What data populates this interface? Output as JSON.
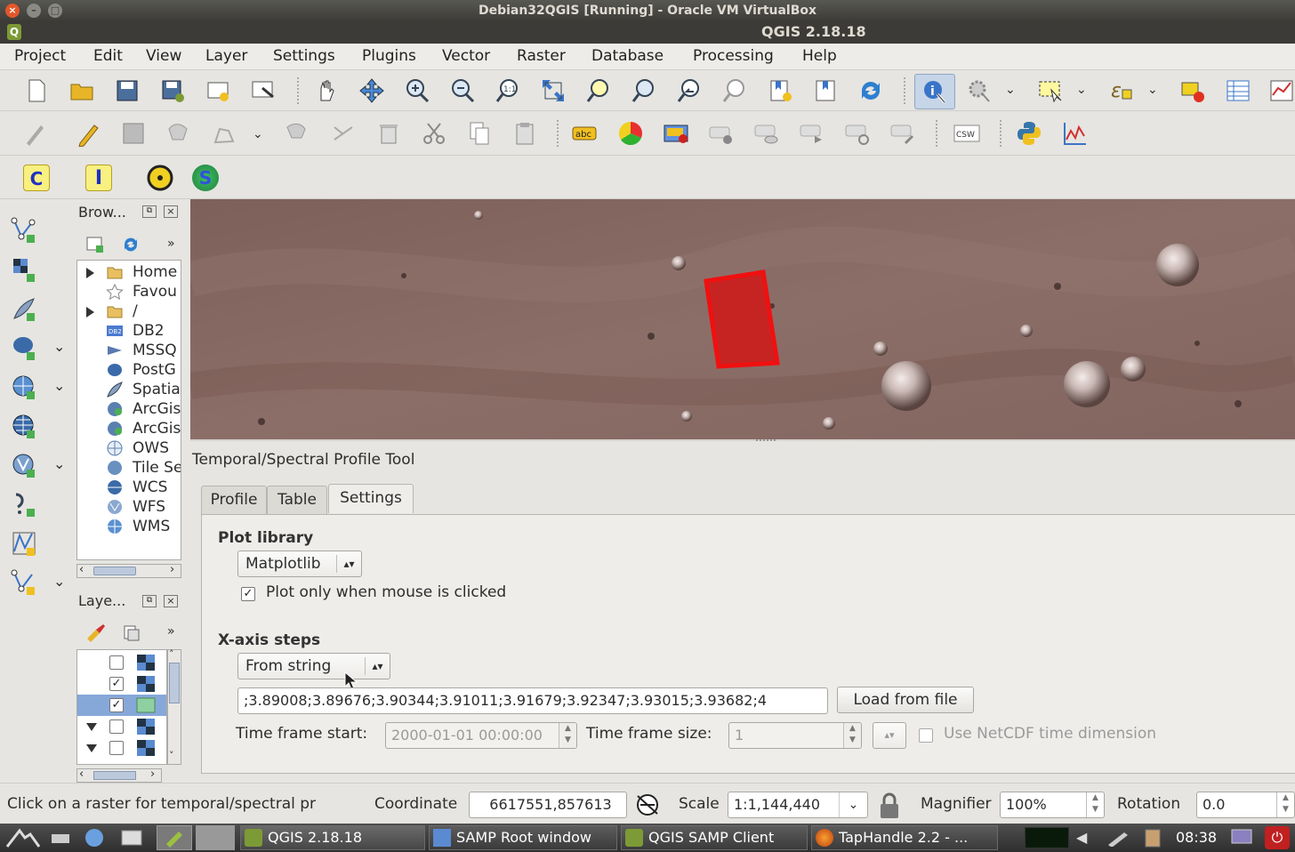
{
  "window": {
    "vbox_title": "Debian32QGIS [Running] - Oracle VM VirtualBox",
    "app_title": "QGIS 2.18.18"
  },
  "menubar": [
    "Project",
    "Edit",
    "View",
    "Layer",
    "Settings",
    "Plugins",
    "Vector",
    "Raster",
    "Database",
    "Processing",
    "Help"
  ],
  "toolbar1_icons": [
    "new-project",
    "open-project",
    "save-project",
    "save-as",
    "new-print-composer",
    "composer-manager",
    "pan",
    "pan-to-selection",
    "zoom-in",
    "zoom-out",
    "zoom-native",
    "zoom-full",
    "zoom-to-selection",
    "zoom-to-layer",
    "zoom-last",
    "zoom-next",
    "new-bookmark",
    "show-bookmarks",
    "refresh",
    "identify",
    "action",
    "select",
    "measure",
    "select-by-value",
    "deselect",
    "attribute-table",
    "statistics"
  ],
  "toolbar2_icons": [
    "edits",
    "toggle-editing",
    "save-layer-edits",
    "add-feature",
    "move-feature",
    "node-tool",
    "delete-selected",
    "cut",
    "copy",
    "paste",
    "label",
    "layer-diagram",
    "highlight-pinned-labels",
    "pin-labels",
    "show-hide-labels",
    "move-label",
    "rotate-label",
    "change-label",
    "csw",
    "python-console",
    "profile-tool"
  ],
  "toolbar3": {
    "c_label": "C",
    "i_label": "I",
    "s_label": "S"
  },
  "browser": {
    "title": "Brow...",
    "items": [
      {
        "label": "Home",
        "expander": true,
        "icon": "folder-icon"
      },
      {
        "label": "Favou",
        "expander": false,
        "icon": "star-icon"
      },
      {
        "label": "/",
        "expander": true,
        "icon": "folder-icon"
      },
      {
        "label": "DB2",
        "expander": false,
        "icon": "db2-icon"
      },
      {
        "label": "MSSQ",
        "expander": false,
        "icon": "mssql-icon"
      },
      {
        "label": "PostG",
        "expander": false,
        "icon": "postgis-icon"
      },
      {
        "label": "Spatia",
        "expander": false,
        "icon": "spatialite-icon"
      },
      {
        "label": "ArcGis",
        "expander": false,
        "icon": "arcgis-icon"
      },
      {
        "label": "ArcGis",
        "expander": false,
        "icon": "arcgis-icon"
      },
      {
        "label": "OWS",
        "expander": false,
        "icon": "ows-icon"
      },
      {
        "label": "Tile Se",
        "expander": false,
        "icon": "tile-icon"
      },
      {
        "label": "WCS",
        "expander": false,
        "icon": "wcs-icon"
      },
      {
        "label": "WFS",
        "expander": false,
        "icon": "wfs-icon"
      },
      {
        "label": "WMS",
        "expander": false,
        "icon": "wms-icon"
      }
    ]
  },
  "layers": {
    "title": "Laye...",
    "rows": [
      {
        "checked": false,
        "expander": false
      },
      {
        "checked": true,
        "expander": false
      },
      {
        "checked": true,
        "expander": false,
        "selected": true
      },
      {
        "checked": false,
        "expander": true
      },
      {
        "checked": false,
        "expander": true
      }
    ]
  },
  "profile": {
    "dock_title": "Temporal/Spectral Profile Tool",
    "tabs": [
      "Profile",
      "Table",
      "Settings"
    ],
    "active_tab": "Settings",
    "plot_library_title": "Plot library",
    "plot_library_value": "Matplotlib",
    "plot_only_clicked_label": "Plot only when mouse is clicked",
    "plot_only_clicked_checked": true,
    "xaxis_title": "X-axis steps",
    "xaxis_mode": "From string",
    "xaxis_string": ";3.89008;3.89676;3.90344;3.91011;3.91679;3.92347;3.93015;3.93682;4",
    "load_from_file_label": "Load from file",
    "time_start_label": "Time frame start:",
    "time_start_value": "2000-01-01 00:00:00",
    "time_size_label": "Time frame size:",
    "time_size_value": "1",
    "netcdf_label": "Use NetCDF time dimension"
  },
  "statusbar": {
    "message": "Click on a raster for temporal/spectral pr",
    "coordinate_label": "Coordinate",
    "coordinate_value": "6617551,857613",
    "scale_label": "Scale",
    "scale_value": "1:1,144,440",
    "magnifier_label": "Magnifier",
    "magnifier_value": "100%",
    "rotation_label": "Rotation",
    "rotation_value": "0.0"
  },
  "taskbar": {
    "tasks": [
      {
        "label": "QGIS 2.18.18",
        "icon": "qgis-icon"
      },
      {
        "label": "SAMP Root window",
        "icon": "window-icon"
      },
      {
        "label": "QGIS SAMP Client",
        "icon": "qgis-icon"
      },
      {
        "label": "TapHandle 2.2 - ...",
        "icon": "firefox-icon"
      }
    ],
    "clock": "08:38"
  },
  "colors": {
    "footprint": "#e01010",
    "map_base": "#8a6a64",
    "selection": "#86a8d8"
  }
}
